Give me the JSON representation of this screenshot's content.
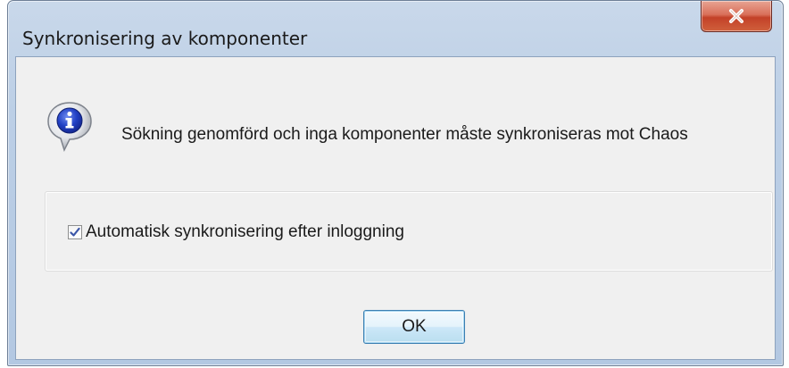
{
  "dialog": {
    "title": "Synkronisering av komponenter",
    "close_icon": "close-icon",
    "info_icon": "information-icon",
    "message": "Sökning genomförd och inga komponenter måste synkroniseras mot Chaos",
    "auto_sync_checkbox": {
      "label": "Automatisk synkronisering efter inloggning",
      "checked": true
    },
    "ok_label": "OK"
  },
  "colors": {
    "titlebar": "#c3d5ea",
    "client_background": "#f0f0f0",
    "close_button": "#c94a30",
    "info_icon_blue": "#1f3fb5",
    "checkmark": "#3b56a8"
  }
}
